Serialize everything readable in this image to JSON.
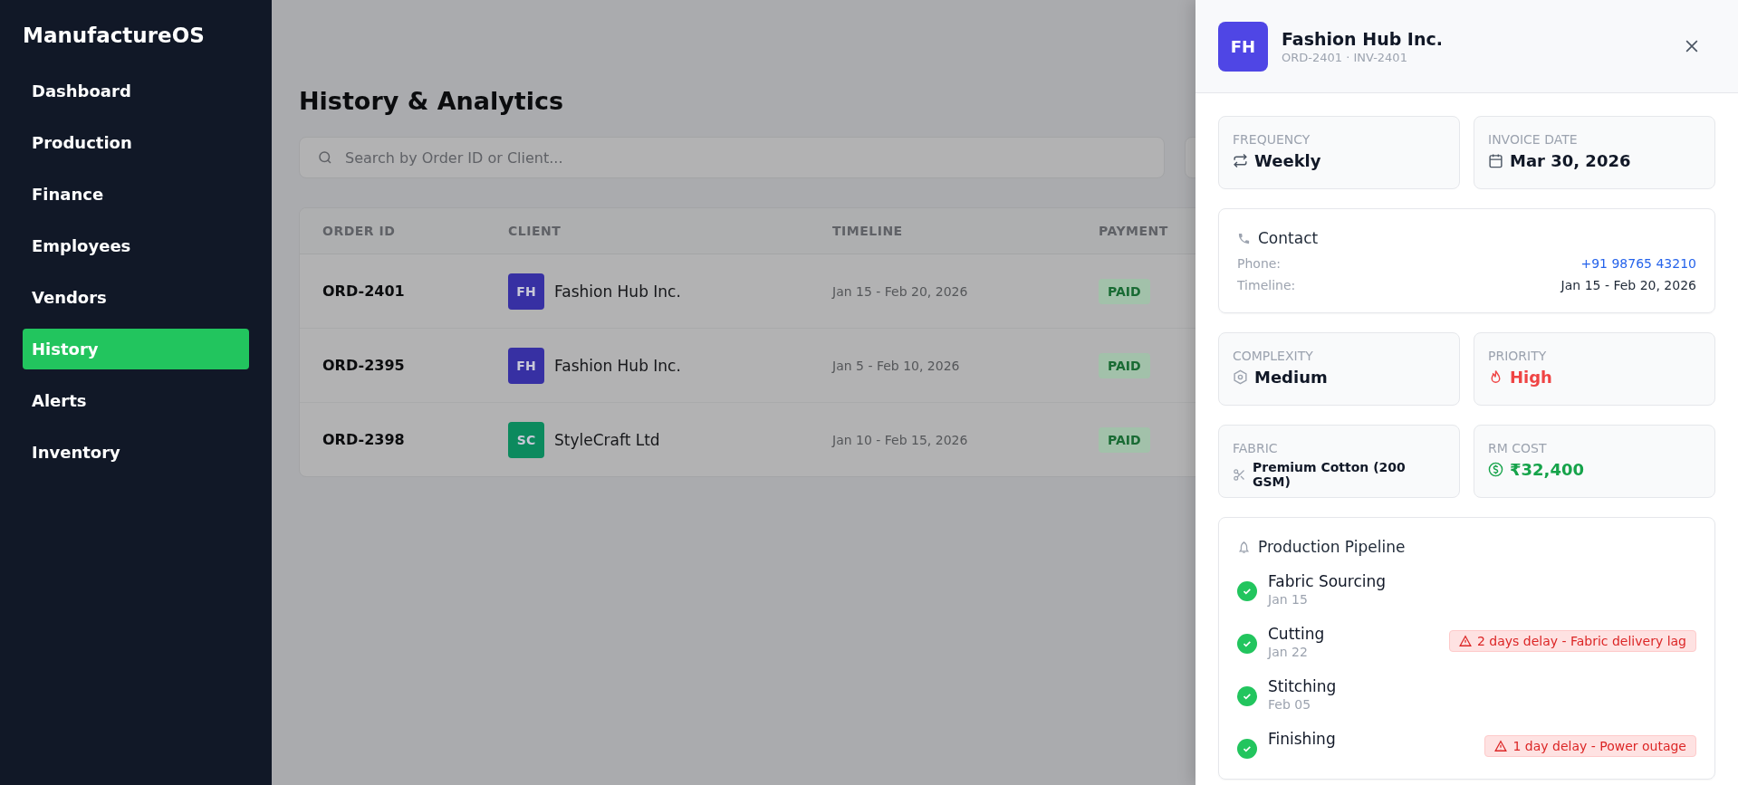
{
  "sidebar": {
    "brand": "ManufactureOS",
    "items": [
      {
        "label": "Dashboard",
        "selected": false
      },
      {
        "label": "Production",
        "selected": false
      },
      {
        "label": "Finance",
        "selected": false
      },
      {
        "label": "Employees",
        "selected": false
      },
      {
        "label": "Vendors",
        "selected": false
      },
      {
        "label": "History",
        "selected": true
      },
      {
        "label": "Alerts",
        "selected": false
      },
      {
        "label": "Inventory",
        "selected": false
      }
    ]
  },
  "page": {
    "title": "History & Analytics",
    "search": {
      "placeholder": "Search by Order ID or Client..."
    },
    "table": {
      "columns": [
        "ORDER ID",
        "CLIENT",
        "TIMELINE",
        "PAYMENT"
      ],
      "rows": [
        {
          "order_id": "ORD-2401",
          "client": {
            "initials": "FH",
            "name": "Fashion Hub Inc.",
            "color": "#3730a3"
          },
          "timeline": "Jan 15 - Feb 20, 2026",
          "payment": {
            "label": "PAID",
            "kind": "paid"
          }
        },
        {
          "order_id": "ORD-2395",
          "client": {
            "initials": "FH",
            "name": "Fashion Hub Inc.",
            "color": "#3730a3"
          },
          "timeline": "Jan 5 - Feb 10, 2026",
          "payment": {
            "label": "PAID",
            "kind": "paid"
          }
        },
        {
          "order_id": "ORD-2398",
          "client": {
            "initials": "SC",
            "name": "StyleCraft Ltd",
            "color": "#0c8a5e"
          },
          "timeline": "Jan 10 - Feb 15, 2026",
          "payment": {
            "label": "PAID",
            "kind": "paid"
          }
        }
      ]
    }
  },
  "drawer": {
    "avatar": {
      "initials": "FH",
      "color": "#4f46e5"
    },
    "title": "Fashion Hub Inc.",
    "subtitle": "ORD-2401 · INV-2401",
    "top_stats": [
      {
        "kind": "frequency",
        "label": "FREQUENCY",
        "value": "Weekly"
      },
      {
        "kind": "date",
        "label": "INVOICE DATE",
        "value": "Mar 30, 2026"
      }
    ],
    "contact": {
      "title": "Contact",
      "rows": [
        {
          "label": "Phone:",
          "value": "+91 98765 43210",
          "kind": "link"
        },
        {
          "label": "Timeline:",
          "value": "Jan 15 - Feb 20, 2026",
          "kind": "text"
        }
      ]
    },
    "stats": [
      {
        "kind": "complexity",
        "label": "COMPLEXITY",
        "value": "Medium"
      },
      {
        "kind": "priority",
        "label": "PRIORITY",
        "value": "High"
      },
      {
        "kind": "fabric",
        "label": "FABRIC",
        "value": "Premium Cotton (200 GSM)"
      },
      {
        "kind": "cost",
        "label": "RM COST",
        "value": "₹32,400"
      }
    ],
    "pipeline": {
      "title": "Production Pipeline",
      "stages": [
        {
          "name": "Fabric Sourcing",
          "date": "Jan 15",
          "done": true
        },
        {
          "name": "Cutting",
          "date": "Jan 22",
          "done": true,
          "delay": "2 days delay - Fabric delivery lag"
        },
        {
          "name": "Stitching",
          "date": "Feb 05",
          "done": true
        },
        {
          "name": "Finishing",
          "done": true,
          "delay": "1 day delay - Power outage"
        }
      ]
    }
  }
}
